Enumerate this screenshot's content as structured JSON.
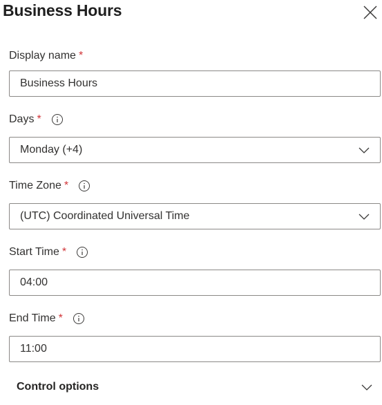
{
  "panel": {
    "title": "Business Hours",
    "close_icon": "close-icon"
  },
  "form": {
    "required_marker": "*",
    "display_name": {
      "label": "Display name",
      "value": "Business Hours"
    },
    "days": {
      "label": "Days",
      "value": "Monday (+4)"
    },
    "time_zone": {
      "label": "Time Zone",
      "value": "(UTC) Coordinated Universal Time"
    },
    "start_time": {
      "label": "Start Time",
      "value": "04:00"
    },
    "end_time": {
      "label": "End Time",
      "value": "11:00"
    }
  },
  "control_options": {
    "label": "Control options"
  },
  "colors": {
    "required": "#d13438",
    "border": "#8a8886",
    "text": "#323130"
  }
}
